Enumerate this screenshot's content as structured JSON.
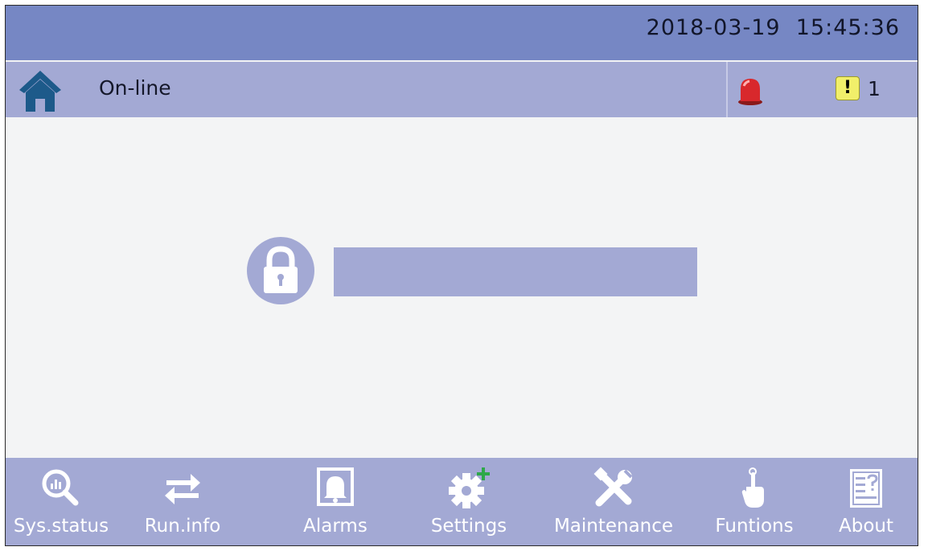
{
  "header": {
    "date": "2018-03-19",
    "time": "15:45:36"
  },
  "status_bar": {
    "home_icon": "home-icon",
    "status": "On-line",
    "alarm_icon": "siren-icon",
    "warning_badge": "!",
    "warning_count": "1"
  },
  "main": {
    "lock_icon": "lock-icon",
    "password_value": ""
  },
  "nav": {
    "items": [
      {
        "label": "Sys.status",
        "icon": "magnifier-chart-icon"
      },
      {
        "label": "Run.info",
        "icon": "swap-arrows-icon"
      },
      {
        "label": "Alarms",
        "icon": "bell-icon"
      },
      {
        "label": "Settings",
        "icon": "gear-plus-icon"
      },
      {
        "label": "Maintenance",
        "icon": "tools-icon"
      },
      {
        "label": "Funtions",
        "icon": "hand-pointer-icon"
      },
      {
        "label": "About",
        "icon": "document-icon"
      }
    ]
  },
  "colors": {
    "top_bar": "#7687c4",
    "status_bar": "#a3a9d4",
    "nav_bar": "#a3a9d4",
    "background": "#f3f4f5",
    "home_icon": "#1d5a8a",
    "siren": "#d8282c",
    "warning": "#f1ef6a",
    "plus_accent": "#2ea84a"
  }
}
